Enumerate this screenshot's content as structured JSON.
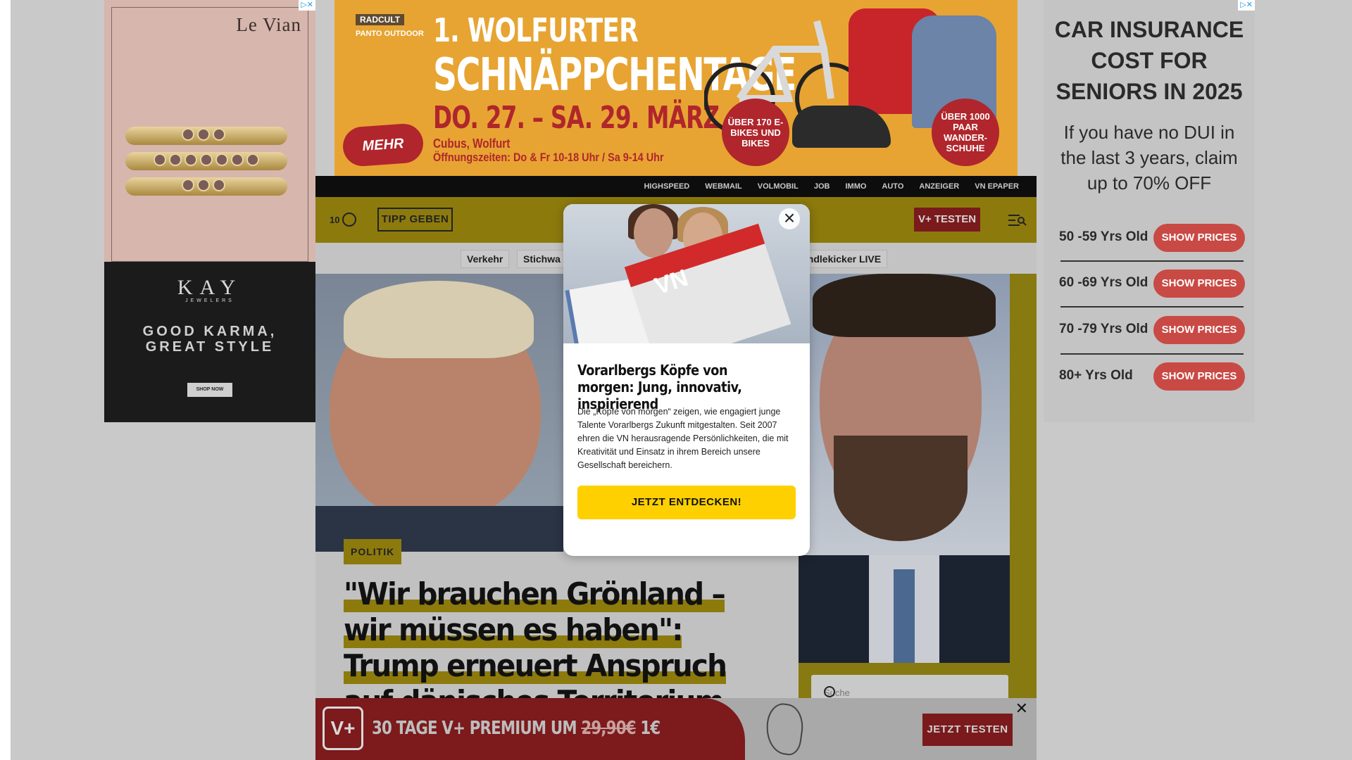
{
  "ads": {
    "left": {
      "brand": "Le Vian",
      "kay": "KAY",
      "kay_sub": "JEWELERS",
      "slogan_1": "GOOD KARMA,",
      "slogan_2": "GREAT STYLE",
      "cta": "SHOP NOW"
    },
    "top": {
      "logo_1": "RADCULT",
      "logo_2": "PANTO OUTDOOR",
      "headline_1": "1. WOLFURTER",
      "headline_2": "SCHNÄPPCHENTAGE",
      "dates": "DO. 27. – SA. 29. MÄRZ",
      "location": "Cubus, Wolfurt",
      "hours": "Öffnungszeiten: Do & Fr 10-18 Uhr / Sa 9-14 Uhr",
      "more": "MEHR INFOS",
      "badge_1": "ÜBER 170 E-BIKES UND BIKES",
      "badge_2": "ÜBER 1000 PAAR WANDER-SCHUHE"
    },
    "right": {
      "title": "CAR INSURANCE COST FOR SENIORS IN 2025",
      "subtitle": "If you have no DUI in the last 3 years, claim up to 70% OFF",
      "rows": [
        {
          "age": "50 -59 Yrs Old",
          "cta": "SHOW PRICES"
        },
        {
          "age": "60 -69 Yrs Old",
          "cta": "SHOW PRICES"
        },
        {
          "age": "70 -79 Yrs Old",
          "cta": "SHOW PRICES"
        },
        {
          "age": "80+ Yrs Old",
          "cta": "SHOW PRICES"
        }
      ]
    }
  },
  "site": {
    "topnav": [
      "HIGHSPEED",
      "WEBMAIL",
      "VOLMOBIL",
      "JOB",
      "IMMO",
      "AUTO",
      "ANZEIGER",
      "VN EPAPER"
    ],
    "temperature": "10",
    "tipp": "TIPP GEBEN",
    "vplus": "V+ TESTEN",
    "chips": [
      "Verkehr",
      "Stichwa",
      "ändlekicker LIVE"
    ],
    "tag": "POLITIK",
    "headline": "\"Wir brauchen Grönland – wir müssen es haben\": Trump erneuert Anspruch auf dänisches Territorium",
    "search_placeholder": "Suche"
  },
  "modal": {
    "image_logo": "VN",
    "title": "Vorarlbergs Köpfe von morgen: Jung, innovativ, inspirierend",
    "body": "Die „Köpfe von morgen“ zeigen, wie engagiert junge Talente Vorarlbergs Zukunft mitgestalten. Seit 2007 ehren die VN herausragende Persönlichkeiten, die mit Kreativität und Einsatz in ihrem Bereich unsere Gesellschaft bereichern.",
    "cta": "JETZT ENTDECKEN!"
  },
  "promo": {
    "logo": "V+",
    "text_before": "30 TAGE V+ PREMIUM UM ",
    "old_price": "29,90€",
    "new_price": " 1€",
    "cta": "JETZT TESTEN"
  }
}
